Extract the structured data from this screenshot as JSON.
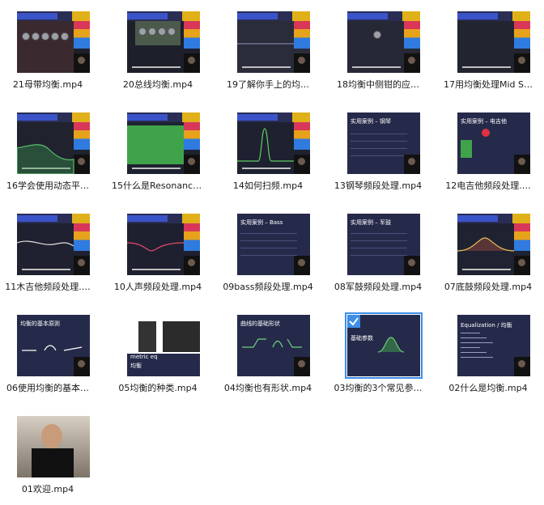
{
  "files": [
    {
      "name": "21母带均衡.mp4",
      "thumb": "eq-plugin-red",
      "selected": false
    },
    {
      "name": "20总线均衡.mp4",
      "thumb": "green-plugin",
      "selected": false
    },
    {
      "name": "19了解你手上的均…",
      "thumb": "dark-daw",
      "selected": false
    },
    {
      "name": "18均衡中侧钳的应…",
      "thumb": "dark-daw-knob",
      "selected": false
    },
    {
      "name": "17用均衡处理Mid S…",
      "thumb": "dark-daw-blue",
      "selected": false
    },
    {
      "name": "16学会使用动态平…",
      "thumb": "eq-green-curve",
      "selected": false
    },
    {
      "name": "15什么是Resonance…",
      "thumb": "green-bar",
      "selected": false
    },
    {
      "name": "14如何扫频.mp4",
      "thumb": "green-peak",
      "selected": false
    },
    {
      "name": "13钢琴频段处理.mp4",
      "thumb": "slide-piano",
      "selected": false
    },
    {
      "name": "12电吉他频段处理.…",
      "thumb": "slide-guitar",
      "selected": false
    },
    {
      "name": "11木吉他频段处理.…",
      "thumb": "eq-curve-dark",
      "selected": false
    },
    {
      "name": "10人声频段处理.mp4",
      "thumb": "eq-curve-pink",
      "selected": false
    },
    {
      "name": "09bass频段处理.mp4",
      "thumb": "slide-bass",
      "selected": false
    },
    {
      "name": "08军鼓频段处理.mp4",
      "thumb": "slide-snare",
      "selected": false
    },
    {
      "name": "07底鼓频段处理.mp4",
      "thumb": "eq-curve-yellow",
      "selected": false
    },
    {
      "name": "06使用均衡的基本…",
      "thumb": "slide-basic",
      "selected": false
    },
    {
      "name": "05均衡的种类.mp4",
      "thumb": "slide-types",
      "selected": false
    },
    {
      "name": "04均衡也有形状.mp4",
      "thumb": "slide-shapes",
      "selected": false
    },
    {
      "name": "03均衡的3个常见参…",
      "thumb": "slide-params",
      "selected": true
    },
    {
      "name": "02什么是均衡.mp4",
      "thumb": "slide-equalization",
      "selected": false
    },
    {
      "name": "01欢迎.mp4",
      "thumb": "person",
      "selected": false
    }
  ],
  "slide_text": {
    "piano": "实用案例 – 钢琴",
    "guitar": "实用案例 – 电吉他",
    "bass": "实用案例 – Bass",
    "snare": "实用案例 – 军鼓",
    "basic": "均衡的基本原则",
    "types": "metric eq",
    "types2": "均衡",
    "shapes": "曲线的基础形状",
    "params": "基础参数",
    "equalization": "Equalization / 均衡"
  },
  "colors": {
    "selection": "#3d8ee6",
    "slide_bg": "#262a4a",
    "eq_green": "#3fa34a"
  }
}
